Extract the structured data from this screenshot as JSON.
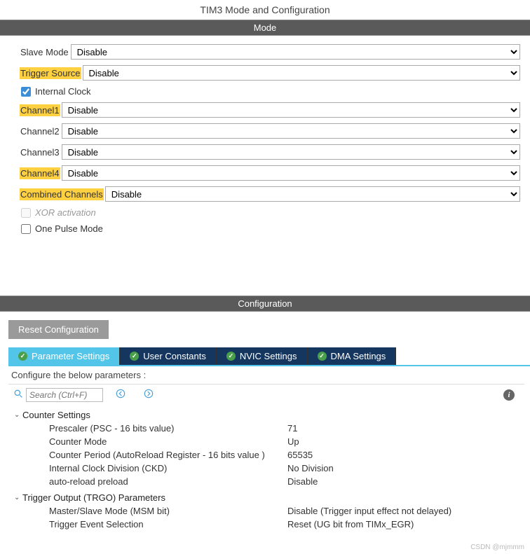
{
  "title": "TIM3 Mode and Configuration",
  "headers": {
    "mode": "Mode",
    "config": "Configuration"
  },
  "mode": {
    "slave_mode_label": "Slave Mode",
    "slave_mode_value": "Disable",
    "trigger_source_label": "Trigger Source",
    "trigger_source_value": "Disable",
    "internal_clock_label": "Internal Clock",
    "internal_clock_checked": true,
    "channel1_label": "Channel1",
    "channel1_value": "Disable",
    "channel2_label": "Channel2",
    "channel2_value": "Disable",
    "channel3_label": "Channel3",
    "channel3_value": "Disable",
    "channel4_label": "Channel4",
    "channel4_value": "Disable",
    "combined_label": "Combined Channels",
    "combined_value": "Disable",
    "xor_label": "XOR activation",
    "one_pulse_label": "One Pulse Mode"
  },
  "config": {
    "reset_label": "Reset Configuration",
    "tabs": {
      "parameter": "Parameter Settings",
      "user_constants": "User Constants",
      "nvic": "NVIC Settings",
      "dma": "DMA Settings"
    },
    "hint": "Configure the below parameters :",
    "search_placeholder": "Search (Ctrl+F)",
    "groups": {
      "counter": {
        "title": "Counter Settings",
        "items": [
          {
            "label": "Prescaler (PSC - 16 bits value)",
            "value": "71"
          },
          {
            "label": "Counter Mode",
            "value": "Up"
          },
          {
            "label": "Counter Period (AutoReload Register - 16 bits value )",
            "value": "65535"
          },
          {
            "label": "Internal Clock Division (CKD)",
            "value": "No Division"
          },
          {
            "label": "auto-reload preload",
            "value": "Disable"
          }
        ]
      },
      "trgo": {
        "title": "Trigger Output (TRGO) Parameters",
        "items": [
          {
            "label": "Master/Slave Mode (MSM bit)",
            "value": "Disable (Trigger input effect not delayed)"
          },
          {
            "label": "Trigger Event Selection",
            "value": "Reset (UG bit from TIMx_EGR)"
          }
        ]
      }
    }
  },
  "watermark": "CSDN @mjmmm"
}
